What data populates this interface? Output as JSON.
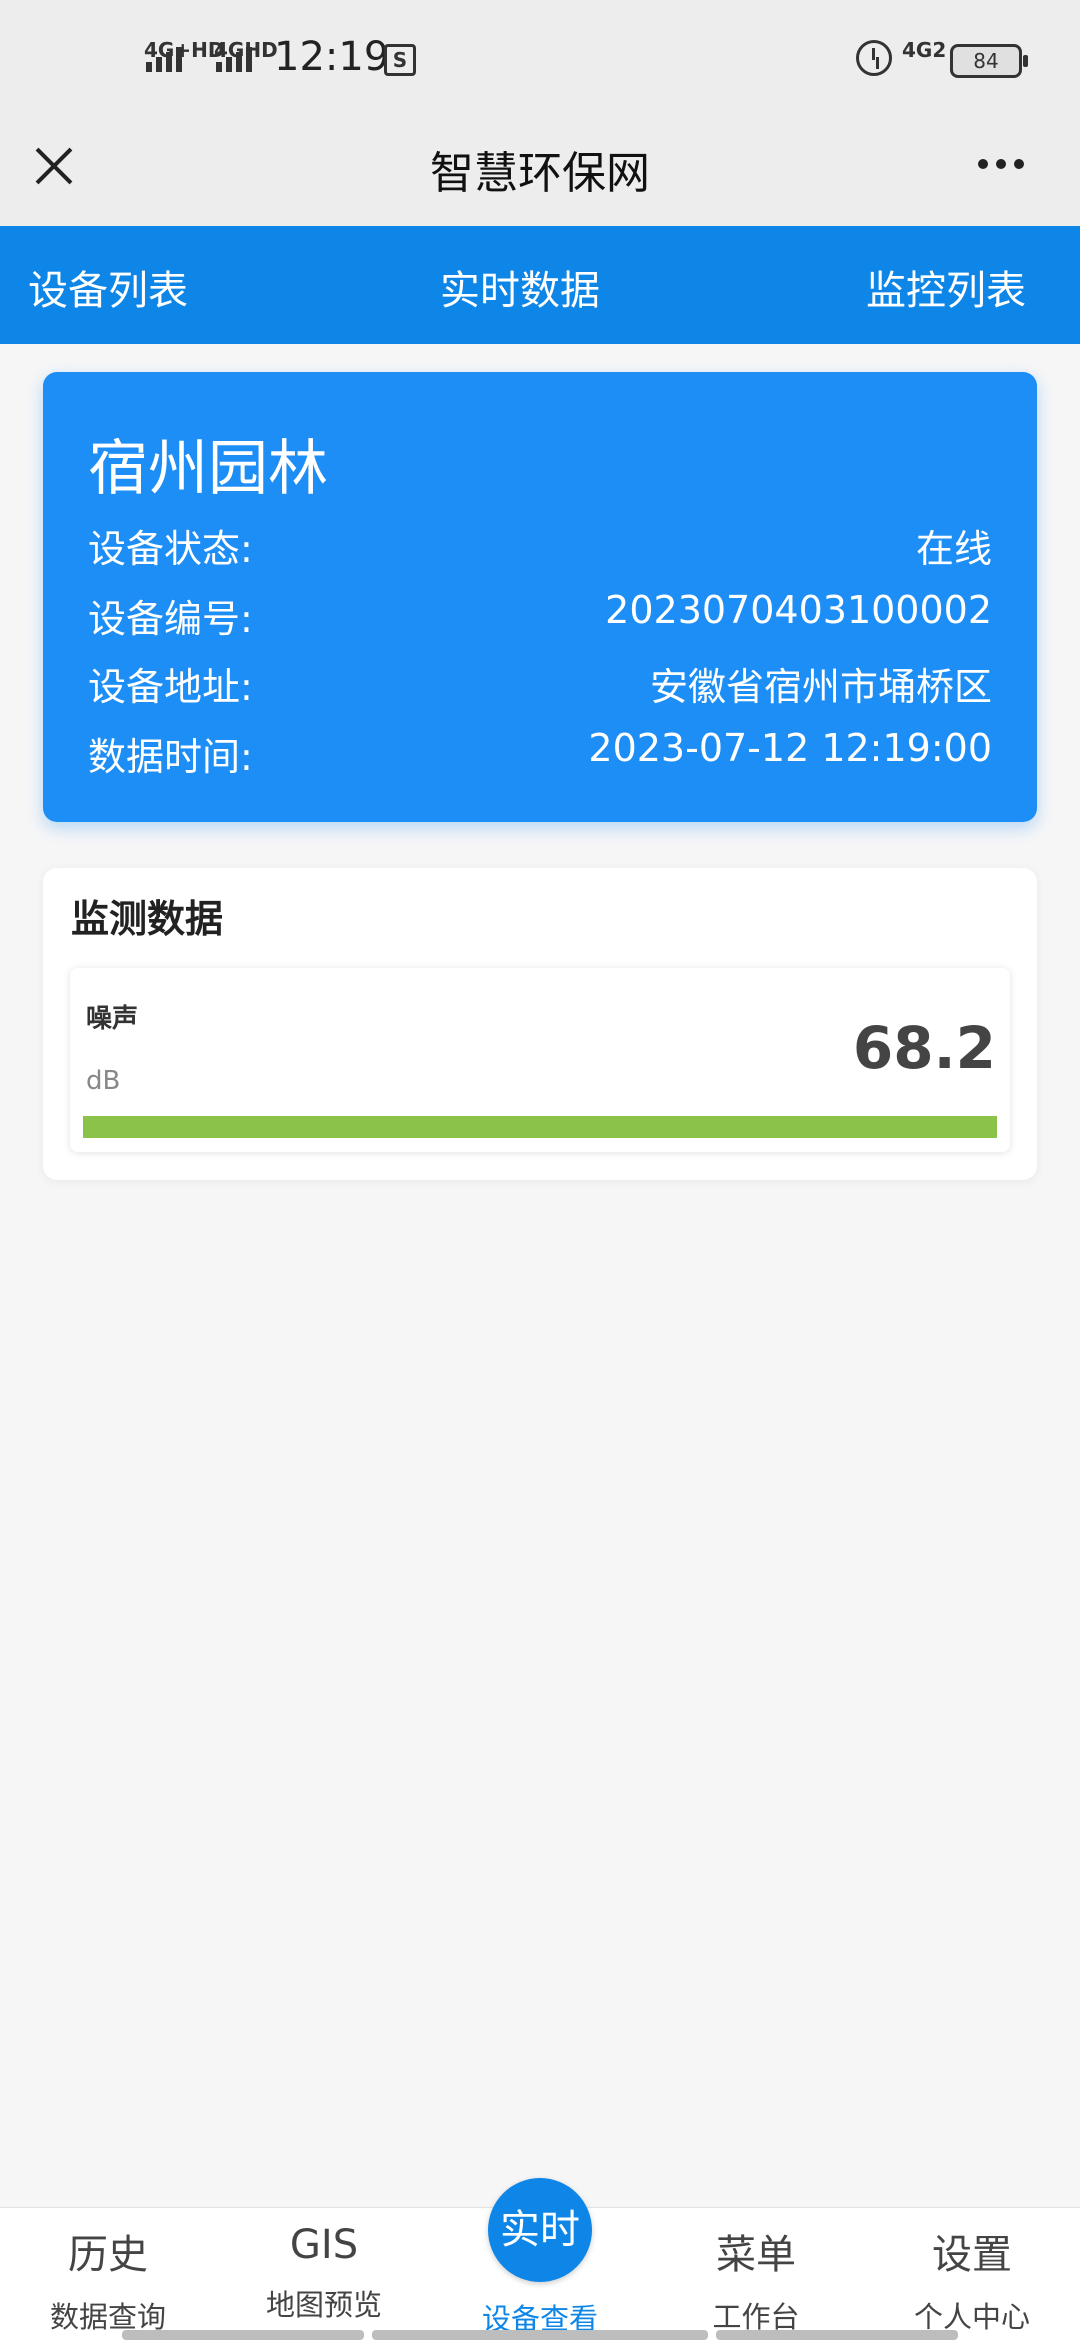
{
  "status_bar": {
    "network1": "4G+HD",
    "network2": "4GHD",
    "time": "12:19",
    "network3": "4G2",
    "battery": "84"
  },
  "titlebar": {
    "title": "智慧环保网"
  },
  "top_nav": {
    "tabs": [
      {
        "label": "设备列表"
      },
      {
        "label": "实时数据"
      },
      {
        "label": "监控列表"
      }
    ]
  },
  "device": {
    "name": "宿州园林",
    "rows": [
      {
        "label": "设备状态:",
        "value": "在线"
      },
      {
        "label": "设备编号:",
        "value": "2023070403100002"
      },
      {
        "label": "设备地址:",
        "value": "安徽省宿州市埇桥区"
      },
      {
        "label": "数据时间:",
        "value": "2023-07-12 12:19:00"
      }
    ]
  },
  "monitor": {
    "title": "监测数据",
    "sensor": {
      "name": "噪声",
      "unit": "dB",
      "value": "68.2",
      "bar_fill_percent": 100,
      "bar_color": "#8bc34a"
    }
  },
  "bottom_nav": {
    "items": [
      {
        "big": "历史",
        "small": "数据查询"
      },
      {
        "big": "GIS",
        "small": "地图预览"
      },
      {
        "big": "实时",
        "small": "设备查看"
      },
      {
        "big": "菜单",
        "small": "工作台"
      },
      {
        "big": "设置",
        "small": "个人中心"
      }
    ]
  },
  "colors": {
    "accent": "#0e86e8",
    "card": "#1d8ef5"
  }
}
